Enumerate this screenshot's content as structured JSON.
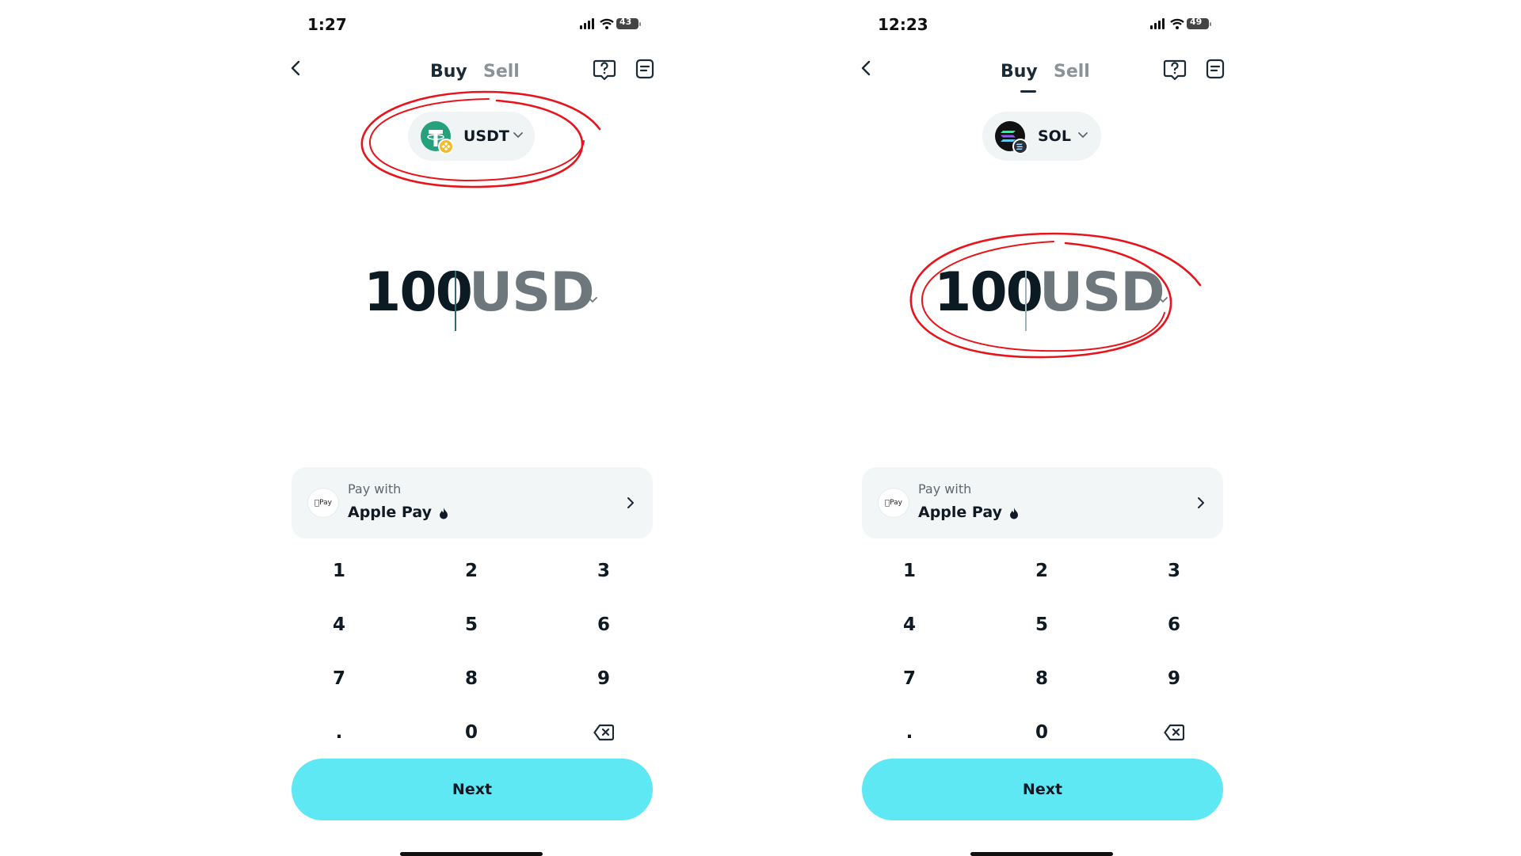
{
  "screens": [
    {
      "status": {
        "time": "1:27",
        "battery": "43"
      },
      "tabs": [
        {
          "label": "Buy"
        },
        {
          "label": "Sell"
        }
      ],
      "token": {
        "symbol": "USDT",
        "icon": "tether-icon",
        "badge": "binance-chain-badge-icon"
      },
      "amount": {
        "value": "100",
        "currency": "USD"
      },
      "pay": {
        "caption": "Pay with",
        "method": "Apple Pay",
        "badge_text": "Pay"
      },
      "keypad": [
        "1",
        "2",
        "3",
        "4",
        "5",
        "6",
        "7",
        "8",
        "9",
        ".",
        "0"
      ],
      "next_label": "Next",
      "highlighted": "token-selector"
    },
    {
      "status": {
        "time": "12:23",
        "battery": "49"
      },
      "tabs": [
        {
          "label": "Buy"
        },
        {
          "label": "Sell"
        }
      ],
      "token": {
        "symbol": "SOL",
        "icon": "solana-icon",
        "badge": "solana-badge-icon"
      },
      "amount": {
        "value": "100",
        "currency": "USD"
      },
      "pay": {
        "caption": "Pay with",
        "method": "Apple Pay",
        "badge_text": "Pay"
      },
      "keypad": [
        "1",
        "2",
        "3",
        "4",
        "5",
        "6",
        "7",
        "8",
        "9",
        ".",
        "0"
      ],
      "next_label": "Next",
      "highlighted": "amount-display"
    }
  ],
  "colors": {
    "accent": "#5ee8f4",
    "annotation": "#e8141c",
    "text_primary": "#0f1a24",
    "text_muted": "#6d777c",
    "card_bg": "#f3f6f7",
    "tether_green": "#26a17b",
    "bnb_yellow": "#f3ba2f"
  }
}
